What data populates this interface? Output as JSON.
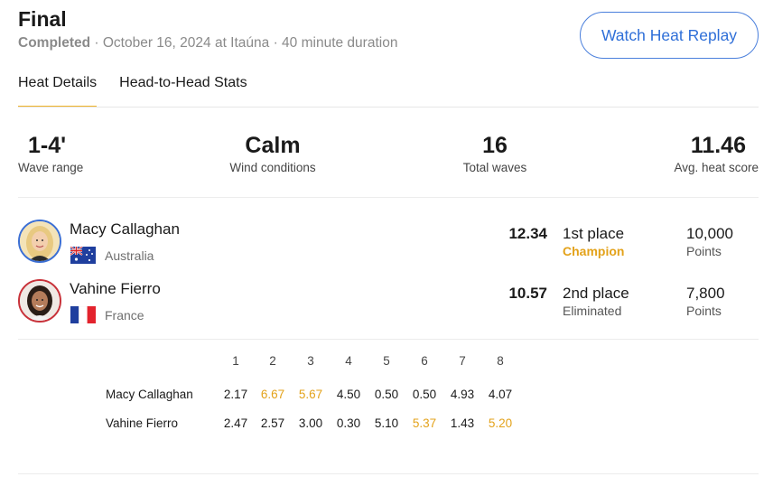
{
  "heat": {
    "title": "Final",
    "status": "Completed",
    "details": " · October 16, 2024 at Itaúna · 40 minute duration",
    "replay_label": "Watch Heat Replay"
  },
  "tabs": [
    {
      "label": "Heat Details",
      "active": true
    },
    {
      "label": "Head-to-Head Stats",
      "active": false
    }
  ],
  "stats": [
    {
      "value": "1-4'",
      "label": "Wave range"
    },
    {
      "value": "Calm",
      "label": "Wind conditions"
    },
    {
      "value": "16",
      "label": "Total waves"
    },
    {
      "value": "11.46",
      "label": "Avg. heat score"
    }
  ],
  "athletes": [
    {
      "name": "Macy Callaghan",
      "country": "Australia",
      "flag": "australia-flag-icon",
      "score": "12.34",
      "place": "1st place",
      "result": "Champion",
      "points": "10,000",
      "points_label": "Points",
      "ring_color": "#3b6fd4"
    },
    {
      "name": "Vahine Fierro",
      "country": "France",
      "flag": "france-flag-icon",
      "score": "10.57",
      "place": "2nd place",
      "result": "Eliminated",
      "points": "7,800",
      "points_label": "Points",
      "ring_color": "#c8323a"
    }
  ],
  "waves": {
    "headers": [
      "1",
      "2",
      "3",
      "4",
      "5",
      "6",
      "7",
      "8"
    ],
    "rows": [
      {
        "name": "Macy Callaghan",
        "scores": [
          "2.17",
          "6.67",
          "5.67",
          "4.50",
          "0.50",
          "0.50",
          "4.93",
          "4.07"
        ],
        "highlight": [
          1,
          2
        ]
      },
      {
        "name": "Vahine Fierro",
        "scores": [
          "2.47",
          "2.57",
          "3.00",
          "0.30",
          "5.10",
          "5.37",
          "1.43",
          "5.20"
        ],
        "highlight": [
          5,
          7
        ]
      }
    ]
  },
  "colors": {
    "accent": "#f0b429",
    "highlight": "#e3a21a",
    "link": "#2f6fd8"
  }
}
